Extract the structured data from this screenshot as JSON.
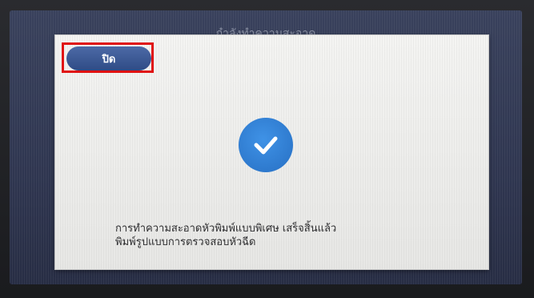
{
  "screen": {
    "background_title": "กำลังทำความสะอาด"
  },
  "dialog": {
    "close_label": "ปิด",
    "status_icon": "checkmark-circle-icon",
    "message_line1": "การทำความสะอาดหัวพิมพ์แบบพิเศษ เสร็จสิ้นแล้ว",
    "message_line2": "พิมพ์รูปแบบการตรวจสอบหัวฉีด"
  },
  "colors": {
    "accent_button": "#3b5894",
    "check_blue": "#2f7fd6",
    "highlight": "#e01212"
  }
}
